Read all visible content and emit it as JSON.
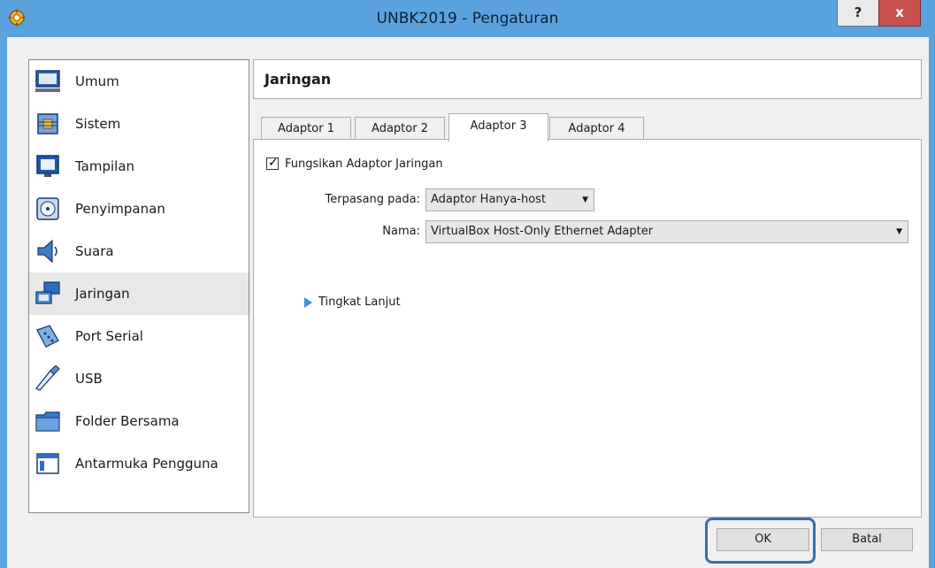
{
  "window": {
    "title": "UNBK2019 - Pengaturan",
    "help_label": "?",
    "close_label": "x"
  },
  "sidebar": {
    "items": [
      {
        "label": "Umum",
        "icon": "monitor-icon"
      },
      {
        "label": "Sistem",
        "icon": "chip-icon"
      },
      {
        "label": "Tampilan",
        "icon": "display-icon"
      },
      {
        "label": "Penyimpanan",
        "icon": "storage-icon"
      },
      {
        "label": "Suara",
        "icon": "speaker-icon"
      },
      {
        "label": "Jaringan",
        "icon": "network-icon",
        "selected": true
      },
      {
        "label": "Port Serial",
        "icon": "serial-port-icon"
      },
      {
        "label": "USB",
        "icon": "usb-icon"
      },
      {
        "label": "Folder Bersama",
        "icon": "folder-icon"
      },
      {
        "label": "Antarmuka Pengguna",
        "icon": "ui-window-icon"
      }
    ]
  },
  "main": {
    "header_title": "Jaringan",
    "tabs": [
      {
        "label": "Adaptor 1"
      },
      {
        "label": "Adaptor 2"
      },
      {
        "label": "Adaptor 3",
        "selected": true
      },
      {
        "label": "Adaptor 4"
      }
    ],
    "enable_checkbox": {
      "label": "Fungsikan Adaptor Jaringan",
      "checked": true
    },
    "attached_to": {
      "label": "Terpasang pada:",
      "value": "Adaptor Hanya-host"
    },
    "name": {
      "label": "Nama:",
      "value": "VirtualBox Host-Only Ethernet Adapter"
    },
    "advanced_label": "Tingkat Lanjut"
  },
  "footer": {
    "ok_label": "OK",
    "cancel_label": "Batal"
  },
  "colors": {
    "title_bar": "#5aa3de",
    "close_button": "#c7504e",
    "highlight_border": "#3a6fa8"
  }
}
